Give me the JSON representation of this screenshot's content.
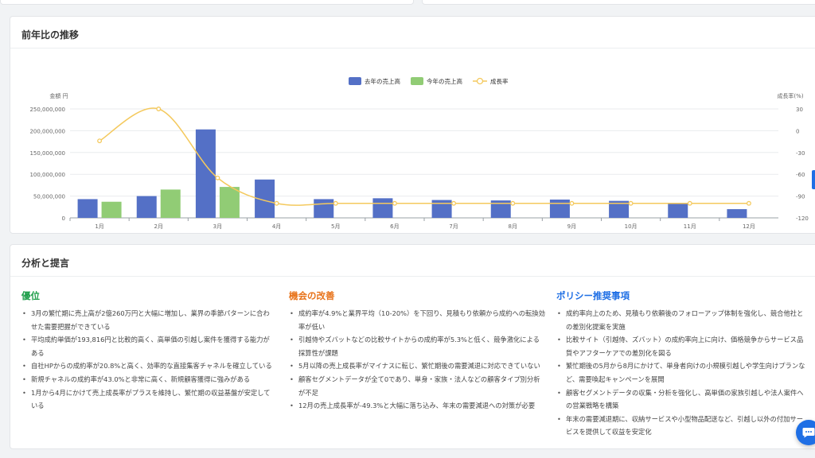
{
  "chart_section": {
    "title": "前年比の推移"
  },
  "chart_data": {
    "type": "bar",
    "categories": [
      "1月",
      "2月",
      "3月",
      "4月",
      "5月",
      "6月",
      "7月",
      "8月",
      "9月",
      "10月",
      "11月",
      "12月"
    ],
    "series": [
      {
        "name": "去年の売上高",
        "type": "bar",
        "color": "#5470c6",
        "values": [
          43000000,
          50000000,
          203000000,
          88000000,
          43000000,
          45000000,
          41000000,
          40000000,
          42000000,
          39000000,
          33000000,
          20000000
        ]
      },
      {
        "name": "今年の売上高",
        "type": "bar",
        "color": "#91cc75",
        "values": [
          37000000,
          65000000,
          71000000,
          null,
          null,
          null,
          null,
          null,
          null,
          null,
          null,
          null
        ]
      },
      {
        "name": "成長率",
        "type": "line",
        "axis": "right",
        "color": "#f4c95d",
        "values": [
          -14,
          30,
          -65,
          -100,
          -100,
          -100,
          -100,
          -100,
          -100,
          -100,
          -100,
          -100
        ]
      }
    ],
    "ylabel": "金額 円",
    "y2label": "成長率(%)",
    "ylim": [
      0,
      250000000
    ],
    "y_ticks": [
      "0",
      "50,000,000",
      "100,000,000",
      "150,000,000",
      "200,000,000",
      "250,000,000"
    ],
    "y2lim": [
      -120,
      30
    ],
    "y2_ticks": [
      "-120",
      "-90",
      "-60",
      "-30",
      "0",
      "30"
    ],
    "legend_position": "top-center",
    "grid": true
  },
  "analysis": {
    "title": "分析と提言",
    "columns": [
      {
        "heading": "優位",
        "color": "#1e9e4a",
        "items": [
          "3月の繁忙期に売上高が2億260万円と大幅に増加し、業界の季節パターンに合わせた需要把握ができている",
          "平均成約単価が193,816円と比較的高く、高単価の引越し案件を獲得する能力がある",
          "自社HPからの成約率が20.8%と高く、効率的な直接集客チャネルを確立している",
          "新規チャネルの成約率が43.0%と非常に高く、新規顧客獲得に強みがある",
          "1月から4月にかけて売上成長率がプラスを維持し、繁忙期の収益基盤が安定している"
        ]
      },
      {
        "heading": "機会の改善",
        "color": "#e8731a",
        "items": [
          "成約率が4.9%と業界平均（10-20%）を下回り、見積もり依頼から成約への転換効率が低い",
          "引越侍やズバットなどの比較サイトからの成約率が5.3%と低く、競争激化による採算性が課題",
          "5月以降の売上成長率がマイナスに転じ、繁忙期後の需要減退に対応できていない",
          "顧客セグメントデータが全て0であり、単身・家族・法人などの顧客タイプ別分析が不足",
          "12月の売上成長率が-49.3%と大幅に落ち込み、年末の需要減退への対策が必要"
        ]
      },
      {
        "heading": "ポリシー推奨事項",
        "color": "#1f6fe5",
        "items": [
          "成約率向上のため、見積もり依頼後のフォローアップ体制を強化し、競合他社との差別化提案を実施",
          "比較サイト（引越侍、ズバット）の成約率向上に向け、価格競争からサービス品質やアフターケアでの差別化を図る",
          "繁忙期後の5月から8月にかけて、単身者向けの小規模引越しや学生向けプランなど、需要喚起キャンペーンを展開",
          "顧客セグメントデータの収集・分析を強化し、高単価の家族引越しや法人案件への営業戦略を構築",
          "年末の需要減退期に、収納サービスや小型物品配送など、引越し以外の付加サービスを提供して収益を安定化"
        ]
      }
    ]
  },
  "widgets": {
    "chat_icon": "chat-bubble-icon",
    "accent_color": "#1f6fe5"
  }
}
